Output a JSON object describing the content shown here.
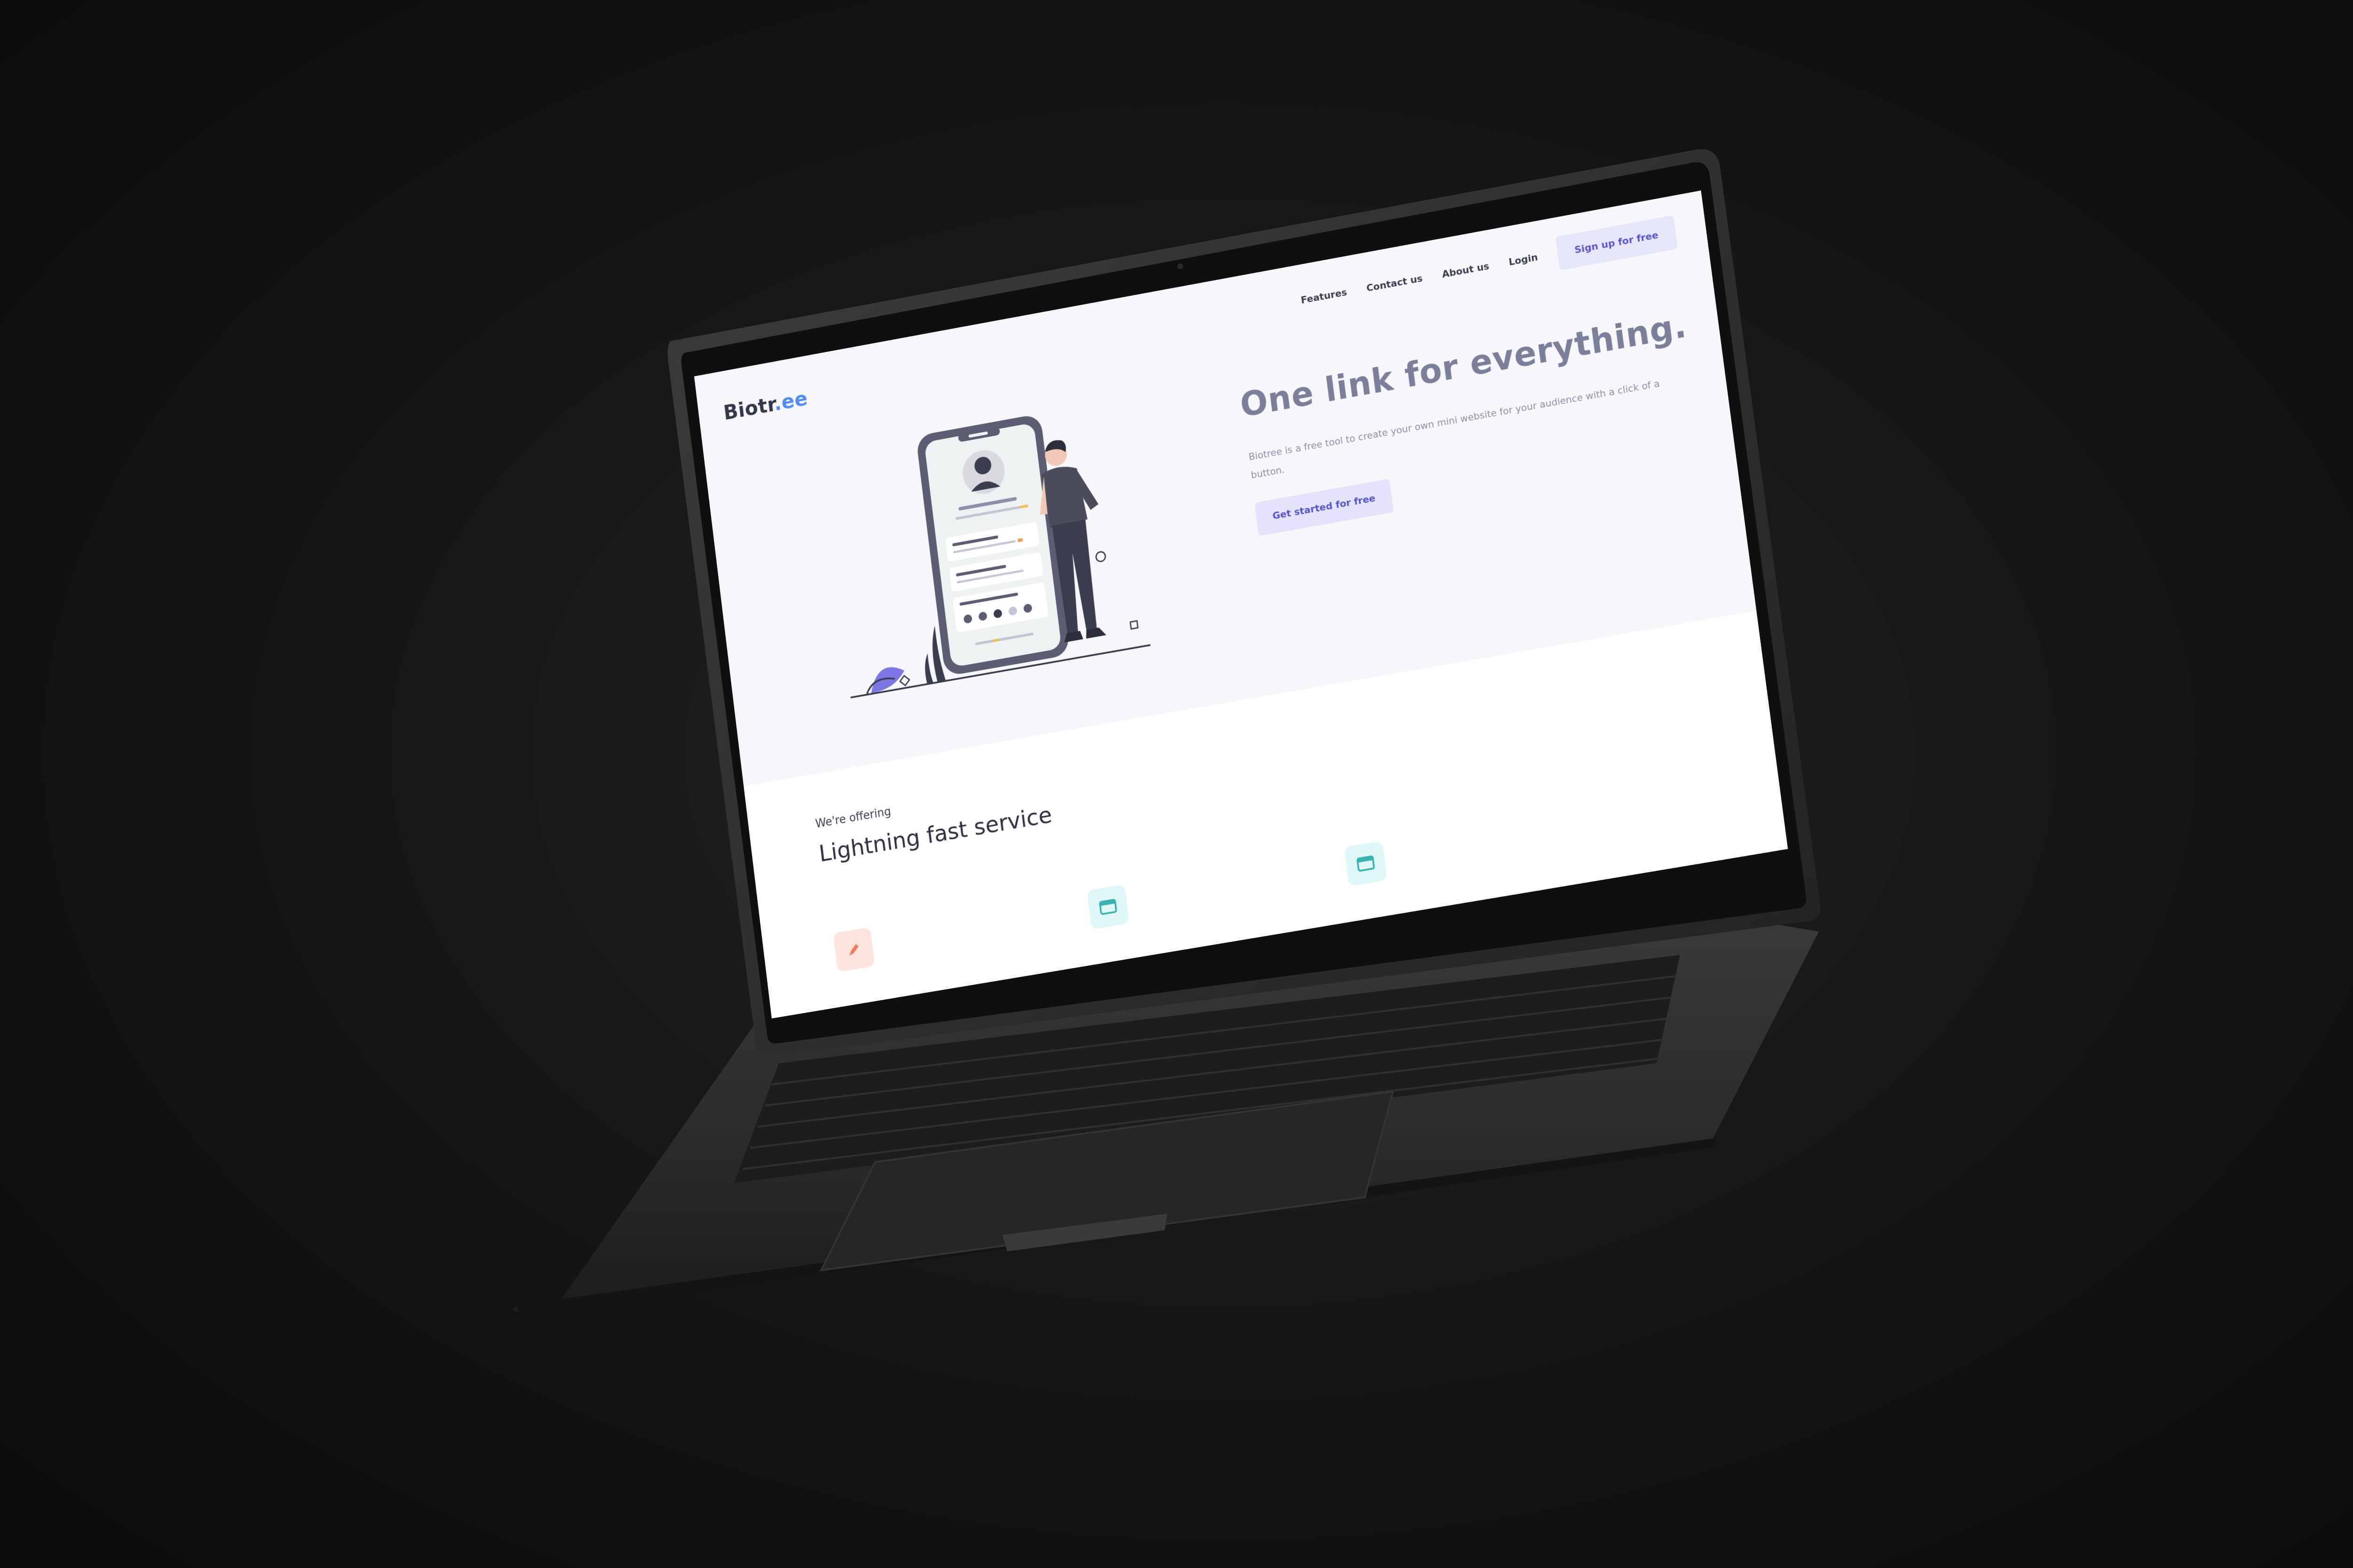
{
  "brand": {
    "name_main": "Biotr",
    "name_accent": ".ee"
  },
  "nav": {
    "features": "Features",
    "contact": "Contact us",
    "about": "About us",
    "login": "Login",
    "signup": "Sign up for free"
  },
  "hero": {
    "title": "One link for everything.",
    "description": "Biotree is a free tool to create your own mini website for your audience with a click of a button.",
    "cta": "Get started for free"
  },
  "offering": {
    "eyebrow": "We're offering",
    "title": "Lightning fast service"
  },
  "icons": {
    "feature_1": "pencil-icon",
    "feature_2": "browser-window-icon",
    "feature_3": "browser-window-icon"
  },
  "colors": {
    "background": "#121212",
    "laptop_body": "#2b2b2d",
    "hero_bg": "#f6f6fb",
    "accent_blue": "#4f8ff5",
    "accent_purple": "#5a55d6",
    "button_bg": "#e6e6fb"
  }
}
